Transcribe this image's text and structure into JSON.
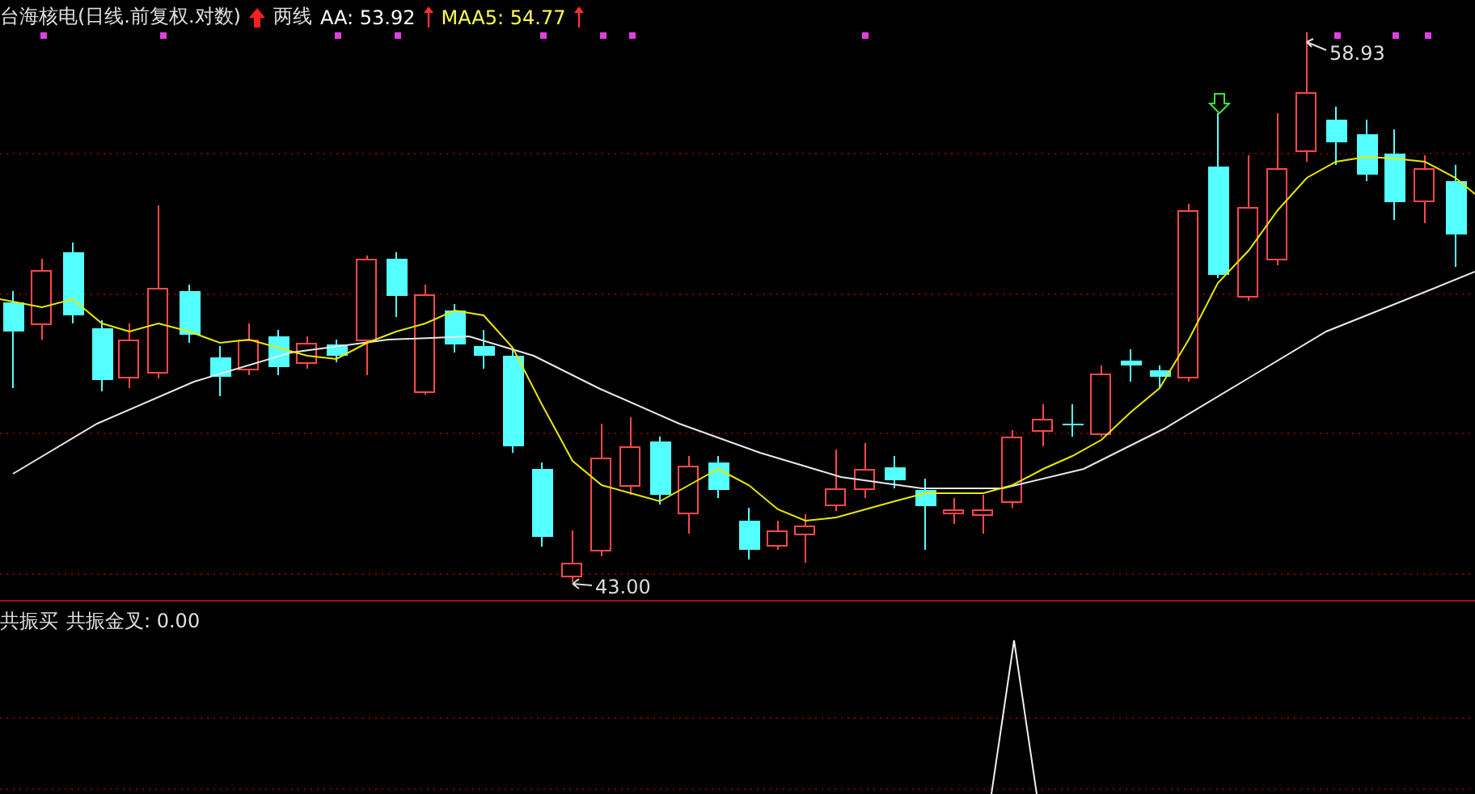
{
  "price_panel": {
    "title": "台海核电(日线.前复权.对数)",
    "indicator_name": "两线",
    "readings": [
      {
        "label": "AA: 53.92",
        "kind": "main"
      },
      {
        "label": "MAA5: 54.77",
        "kind": "average"
      }
    ],
    "high_label": "58.93",
    "low_label": "43.00"
  },
  "signal_panel": {
    "title": "共振买",
    "reading": "共振金叉: 0.00"
  }
}
